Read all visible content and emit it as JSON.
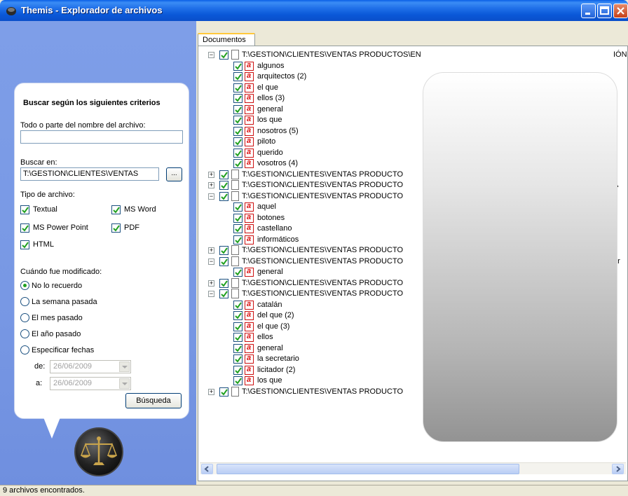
{
  "window": {
    "title": "Themis - Explorador de archivos"
  },
  "search": {
    "heading": "Buscar según los siguientes criterios",
    "name_label": "Todo o parte del nombre del archivo:",
    "name_value": "",
    "path_label": "Buscar en:",
    "path_value": "T:\\GESTION\\CLIENTES\\VENTAS",
    "browse_label": "...",
    "filetype_label": "Tipo de archivo:",
    "filetypes": [
      {
        "label": "Textual",
        "checked": true
      },
      {
        "label": "MS Word",
        "checked": true
      },
      {
        "label": "MS Power Point",
        "checked": true
      },
      {
        "label": "PDF",
        "checked": true
      },
      {
        "label": "HTML",
        "checked": true
      }
    ],
    "modified_label": "Cuándo fue modificado:",
    "modified_options": [
      "No lo recuerdo",
      "La semana pasada",
      "El mes pasado",
      "El año pasado",
      "Especificar fechas"
    ],
    "modified_selected": "No lo recuerdo",
    "from_label": "de:",
    "from_date": "26/06/2009",
    "to_label": "a:",
    "to_date": "26/06/2009",
    "search_button": "Búsqueda"
  },
  "results": {
    "tab_label": "Documentos",
    "path_prefix": "T:\\GESTION\\CLIENTES\\VENTAS PRODUCTO",
    "first_path": "T:\\GESTION\\CLIENTES\\VENTAS PRODUCTOS\\EN",
    "first_path_tail": "IÓN DE",
    "groups": [
      {
        "expanded": true,
        "path": "T:\\GESTION\\CLIENTES\\VENTAS PRODUCTOS\\EN",
        "tail": "IÓN DE",
        "items": [
          "algunos",
          "arquitectos (2)",
          "el que",
          "ellos (3)",
          "general",
          "los que",
          "nosotros (5)",
          "piloto",
          "querido",
          "vosotros (4)"
        ]
      },
      {
        "expanded": false,
        "path": "T:\\GESTION\\CLIENTES\\VENTAS PRODUCTO",
        "tail": "c",
        "items": []
      },
      {
        "expanded": false,
        "path": "T:\\GESTION\\CLIENTES\\VENTAS PRODUCTO",
        "tail": "A",
        "items": []
      },
      {
        "expanded": true,
        "path": "T:\\GESTION\\CLIENTES\\VENTAS PRODUCTO",
        "tail": "u",
        "items": [
          "aquel",
          "botones",
          "castellano",
          "informáticos"
        ]
      },
      {
        "expanded": false,
        "path": "T:\\GESTION\\CLIENTES\\VENTAS PRODUCTO",
        "tail": "",
        "items": []
      },
      {
        "expanded": true,
        "path": "T:\\GESTION\\CLIENTES\\VENTAS PRODUCTO",
        "tail": "ar",
        "items": [
          "general"
        ]
      },
      {
        "expanded": false,
        "path": "T:\\GESTION\\CLIENTES\\VENTAS PRODUCTO",
        "tail": "d",
        "items": []
      },
      {
        "expanded": true,
        "path": "T:\\GESTION\\CLIENTES\\VENTAS PRODUCTO",
        "tail": "d",
        "items": [
          "catalán",
          "del que (2)",
          "el que (3)",
          "ellos",
          "general",
          "la secretario",
          "licitador (2)",
          "los que"
        ]
      },
      {
        "expanded": false,
        "path": "T:\\GESTION\\CLIENTES\\VENTAS PRODUCTO",
        "tail": "d",
        "items": []
      }
    ]
  },
  "status": {
    "text": "9 archivos encontrados."
  }
}
